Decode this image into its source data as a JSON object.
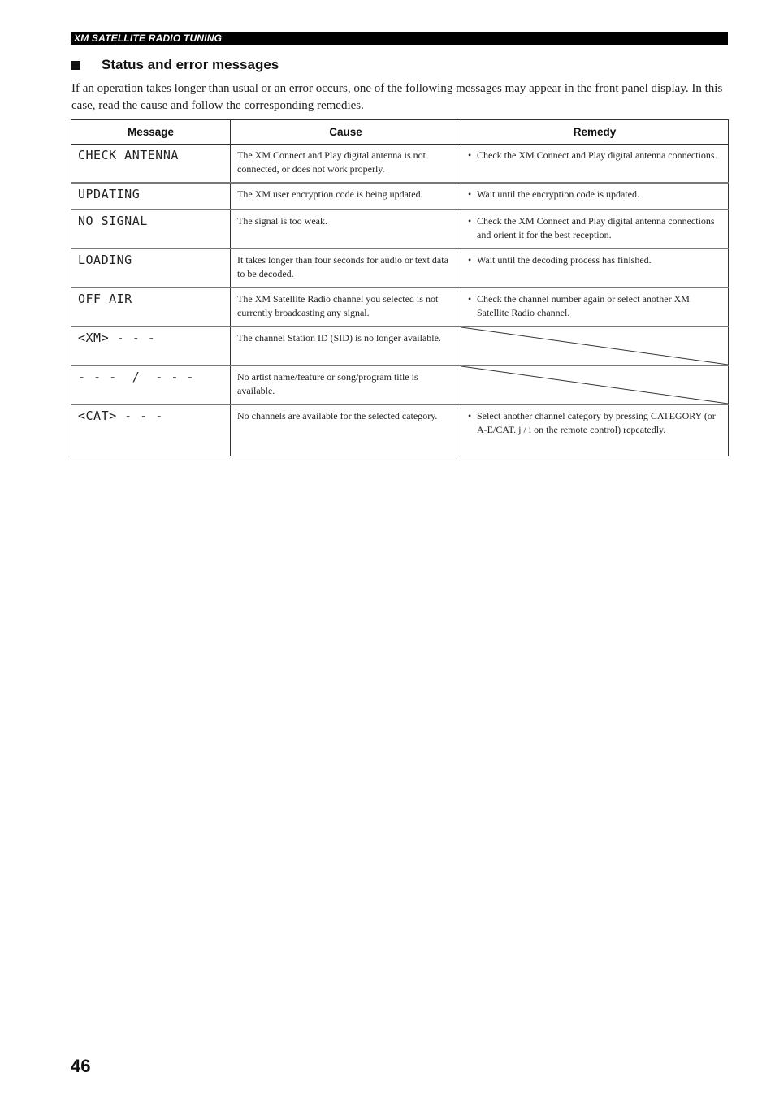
{
  "header": {
    "section_label": "XM SATELLITE RADIO TUNING"
  },
  "section": {
    "title": "Status and error messages",
    "intro": "If an operation takes longer than usual or an error occurs, one of the following messages may appear in the front panel display. In this case, read the cause and follow the corresponding remedies."
  },
  "table": {
    "columns": [
      "Message",
      "Cause",
      "Remedy"
    ],
    "rows": [
      {
        "message": "CHECK ANTENNA",
        "cause": "The XM Connect and Play digital antenna is not connected, or does not work properly.",
        "remedy": "Check the XM Connect and Play digital antenna connections."
      },
      {
        "message": "UPDATING",
        "cause": "The XM user encryption code is being updated.",
        "remedy": "Wait until the encryption code is updated."
      },
      {
        "message": "NO SIGNAL",
        "cause": "The signal is too weak.",
        "remedy": "Check the XM Connect and Play digital antenna connections and orient it for the best reception."
      },
      {
        "message": "LOADING",
        "cause": "It takes longer than four seconds for audio or text data to be decoded.",
        "remedy": "Wait until the decoding process has finished."
      },
      {
        "message": "OFF AIR",
        "cause": "The XM Satellite Radio channel you selected is not currently broadcasting any signal.",
        "remedy": "Check the channel number again or select another XM Satellite Radio channel."
      },
      {
        "message": "<XM> - - -",
        "cause": "The channel Station ID (SID) is no longer available.",
        "remedy": null
      },
      {
        "message": "- - -  /  - - -",
        "cause": "No artist name/feature or song/program title is available.",
        "remedy": null
      },
      {
        "message": "<CAT> - - -",
        "cause": "No channels are available for the selected category.",
        "remedy": "Select another channel category by pressing CATEGORY (or A-E/CAT. j / i on the remote control) repeatedly."
      }
    ],
    "bullet": "•"
  },
  "footer": {
    "page_number": "46"
  }
}
